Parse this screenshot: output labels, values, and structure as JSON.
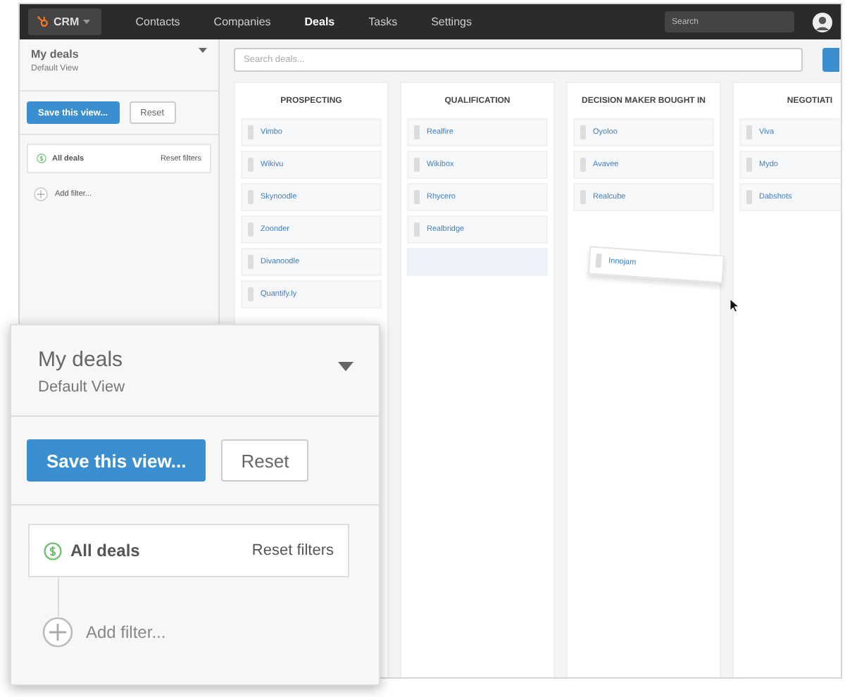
{
  "nav": {
    "logo": "CRM",
    "items": [
      {
        "label": "Contacts",
        "selected": false
      },
      {
        "label": "Companies",
        "selected": false
      },
      {
        "label": "Deals",
        "selected": true
      },
      {
        "label": "Tasks",
        "selected": false
      },
      {
        "label": "Settings",
        "selected": false
      }
    ],
    "search": {
      "placeholder": "Search"
    }
  },
  "sidebar": {
    "title": "My deals",
    "subtitle": "Default View",
    "save_button": "Save this view...",
    "reset_button": "Reset",
    "filter": {
      "label": "All deals",
      "action": "Reset filters"
    },
    "add_filter": "Add filter..."
  },
  "board": {
    "search": {
      "placeholder": "Search deals..."
    },
    "columns": [
      {
        "title": "PROSPECTING",
        "cards": [
          {
            "kind": "deal",
            "name": "Vimbo"
          },
          {
            "kind": "deal",
            "name": "Wikivu"
          },
          {
            "kind": "deal",
            "name": "Skynoodle"
          },
          {
            "kind": "deal",
            "name": "Zoonder"
          },
          {
            "kind": "deal",
            "name": "Divanoodle"
          },
          {
            "kind": "deal",
            "name": "Quantify.ly"
          }
        ]
      },
      {
        "title": "QUALIFICATION",
        "cards": [
          {
            "kind": "deal",
            "name": "Realfire"
          },
          {
            "kind": "deal",
            "name": "Wikibox"
          },
          {
            "kind": "deal",
            "name": "Rhycero"
          },
          {
            "kind": "deal",
            "name": "Realbridge"
          },
          {
            "kind": "slot"
          }
        ]
      },
      {
        "title": "DECISION MAKER BOUGHT IN",
        "cards": [
          {
            "kind": "deal",
            "name": "Oyoloo"
          },
          {
            "kind": "deal",
            "name": "Avavee"
          },
          {
            "kind": "deal",
            "name": "Realcube"
          }
        ]
      },
      {
        "title": "NEGOTIATI",
        "cards": [
          {
            "kind": "deal",
            "name": "Viva"
          },
          {
            "kind": "deal",
            "name": "Mydo"
          },
          {
            "kind": "deal",
            "name": "Dabshots"
          }
        ]
      }
    ],
    "dragged_card": {
      "name": "Innojam"
    }
  },
  "zoom_callout": {
    "title": "My deals",
    "subtitle": "Default View",
    "save_button": "Save this view...",
    "reset_button": "Reset",
    "filter": {
      "label": "All deals",
      "action": "Reset filters"
    },
    "add_filter": "Add filter..."
  }
}
